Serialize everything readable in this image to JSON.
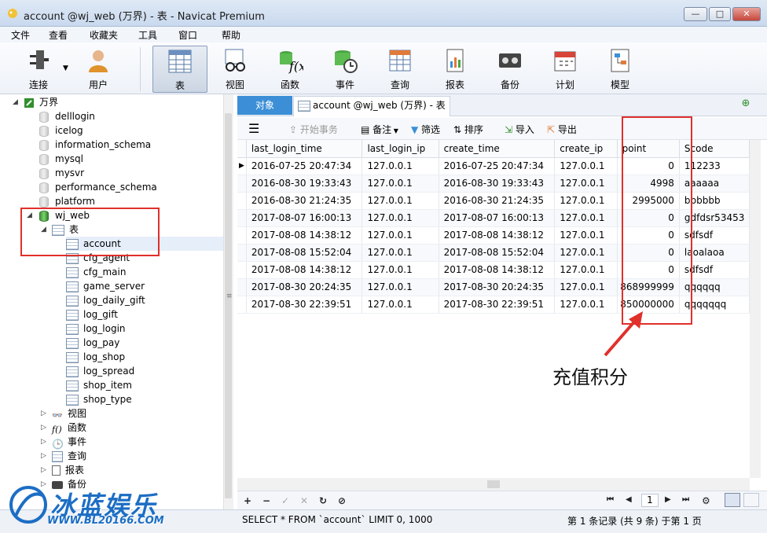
{
  "window": {
    "title": "account @wj_web (万界) - 表 - Navicat Premium",
    "controls": [
      "—",
      "□",
      "✕"
    ]
  },
  "menu": [
    "文件",
    "查看",
    "收藏夹",
    "工具",
    "窗口",
    "帮助"
  ],
  "toolbar": [
    {
      "id": "connect",
      "label": "连接",
      "icon": "plug-icon"
    },
    {
      "id": "user",
      "label": "用户",
      "icon": "user-icon"
    },
    {
      "id": "table",
      "label": "表",
      "icon": "table-icon",
      "active": true
    },
    {
      "id": "view",
      "label": "视图",
      "icon": "glasses-icon"
    },
    {
      "id": "function",
      "label": "函数",
      "icon": "function-icon"
    },
    {
      "id": "event",
      "label": "事件",
      "icon": "clock-db-icon"
    },
    {
      "id": "query",
      "label": "查询",
      "icon": "query-icon"
    },
    {
      "id": "report",
      "label": "报表",
      "icon": "report-icon"
    },
    {
      "id": "backup",
      "label": "备份",
      "icon": "tape-icon"
    },
    {
      "id": "schedule",
      "label": "计划",
      "icon": "calendar-icon"
    },
    {
      "id": "model",
      "label": "模型",
      "icon": "model-icon"
    }
  ],
  "tree": {
    "connection": "万界",
    "databases": [
      "delllogin",
      "icelog",
      "information_schema",
      "mysql",
      "mysvr",
      "performance_schema",
      "platform"
    ],
    "active_db": "wj_web",
    "tables_group": "表",
    "tables": [
      "account",
      "cfg_agent",
      "cfg_main",
      "game_server",
      "log_daily_gift",
      "log_gift",
      "log_login",
      "log_pay",
      "log_shop",
      "log_spread",
      "shop_item",
      "shop_type"
    ],
    "selected_table": "account",
    "groups": [
      {
        "label": "视图",
        "icon": "glasses-icon"
      },
      {
        "label": "函数",
        "icon": "function-icon"
      },
      {
        "label": "事件",
        "icon": "clock-icon"
      },
      {
        "label": "查询",
        "icon": "query-icon"
      },
      {
        "label": "报表",
        "icon": "report-icon"
      },
      {
        "label": "备份",
        "icon": "tape-icon"
      }
    ]
  },
  "tabs": {
    "objects": "对象",
    "account": "account @wj_web (万界) - 表"
  },
  "subtoolbar": {
    "begin_tx": "开始事务",
    "note": "备注",
    "filter": "筛选",
    "sort": "排序",
    "import": "导入",
    "export": "导出"
  },
  "grid": {
    "columns": [
      "last_login_time",
      "last_login_ip",
      "create_time",
      "create_ip",
      "point",
      "Scode"
    ],
    "rows": [
      [
        "2016-07-25 20:47:34",
        "127.0.0.1",
        "2016-07-25 20:47:34",
        "127.0.0.1",
        "0",
        "112233"
      ],
      [
        "2016-08-30 19:33:43",
        "127.0.0.1",
        "2016-08-30 19:33:43",
        "127.0.0.1",
        "4998",
        "aaaaaa"
      ],
      [
        "2016-08-30 21:24:35",
        "127.0.0.1",
        "2016-08-30 21:24:35",
        "127.0.0.1",
        "2995000",
        "bbbbbb"
      ],
      [
        "2017-08-07 16:00:13",
        "127.0.0.1",
        "2017-08-07 16:00:13",
        "127.0.0.1",
        "0",
        "gdfdsr53453"
      ],
      [
        "2017-08-08 14:38:12",
        "127.0.0.1",
        "2017-08-08 14:38:12",
        "127.0.0.1",
        "0",
        "sdfsdf"
      ],
      [
        "2017-08-08 15:52:04",
        "127.0.0.1",
        "2017-08-08 15:52:04",
        "127.0.0.1",
        "0",
        "laoalaoa"
      ],
      [
        "2017-08-08 14:38:12",
        "127.0.0.1",
        "2017-08-08 14:38:12",
        "127.0.0.1",
        "0",
        "sdfsdf"
      ],
      [
        "2017-08-30 20:24:35",
        "127.0.0.1",
        "2017-08-30 20:24:35",
        "127.0.0.1",
        "868999999",
        "qqqqqq"
      ],
      [
        "2017-08-30 22:39:51",
        "127.0.0.1",
        "2017-08-30 22:39:51",
        "127.0.0.1",
        "850000000",
        "qqqqqqq"
      ]
    ]
  },
  "nav": {
    "page": "1"
  },
  "status": {
    "sql": "SELECT * FROM `account` LIMIT 0, 1000",
    "records": "第 1 条记录 (共 9 条) 于第 1 页"
  },
  "annotation": "充值积分",
  "watermark": {
    "logo_text": "冰蓝娱乐",
    "url": "WWW.BL20166.COM"
  },
  "colors": {
    "highlight": "#e0302b",
    "tab_active": "#3c8fd6",
    "watermark": "#1c6ec4"
  }
}
